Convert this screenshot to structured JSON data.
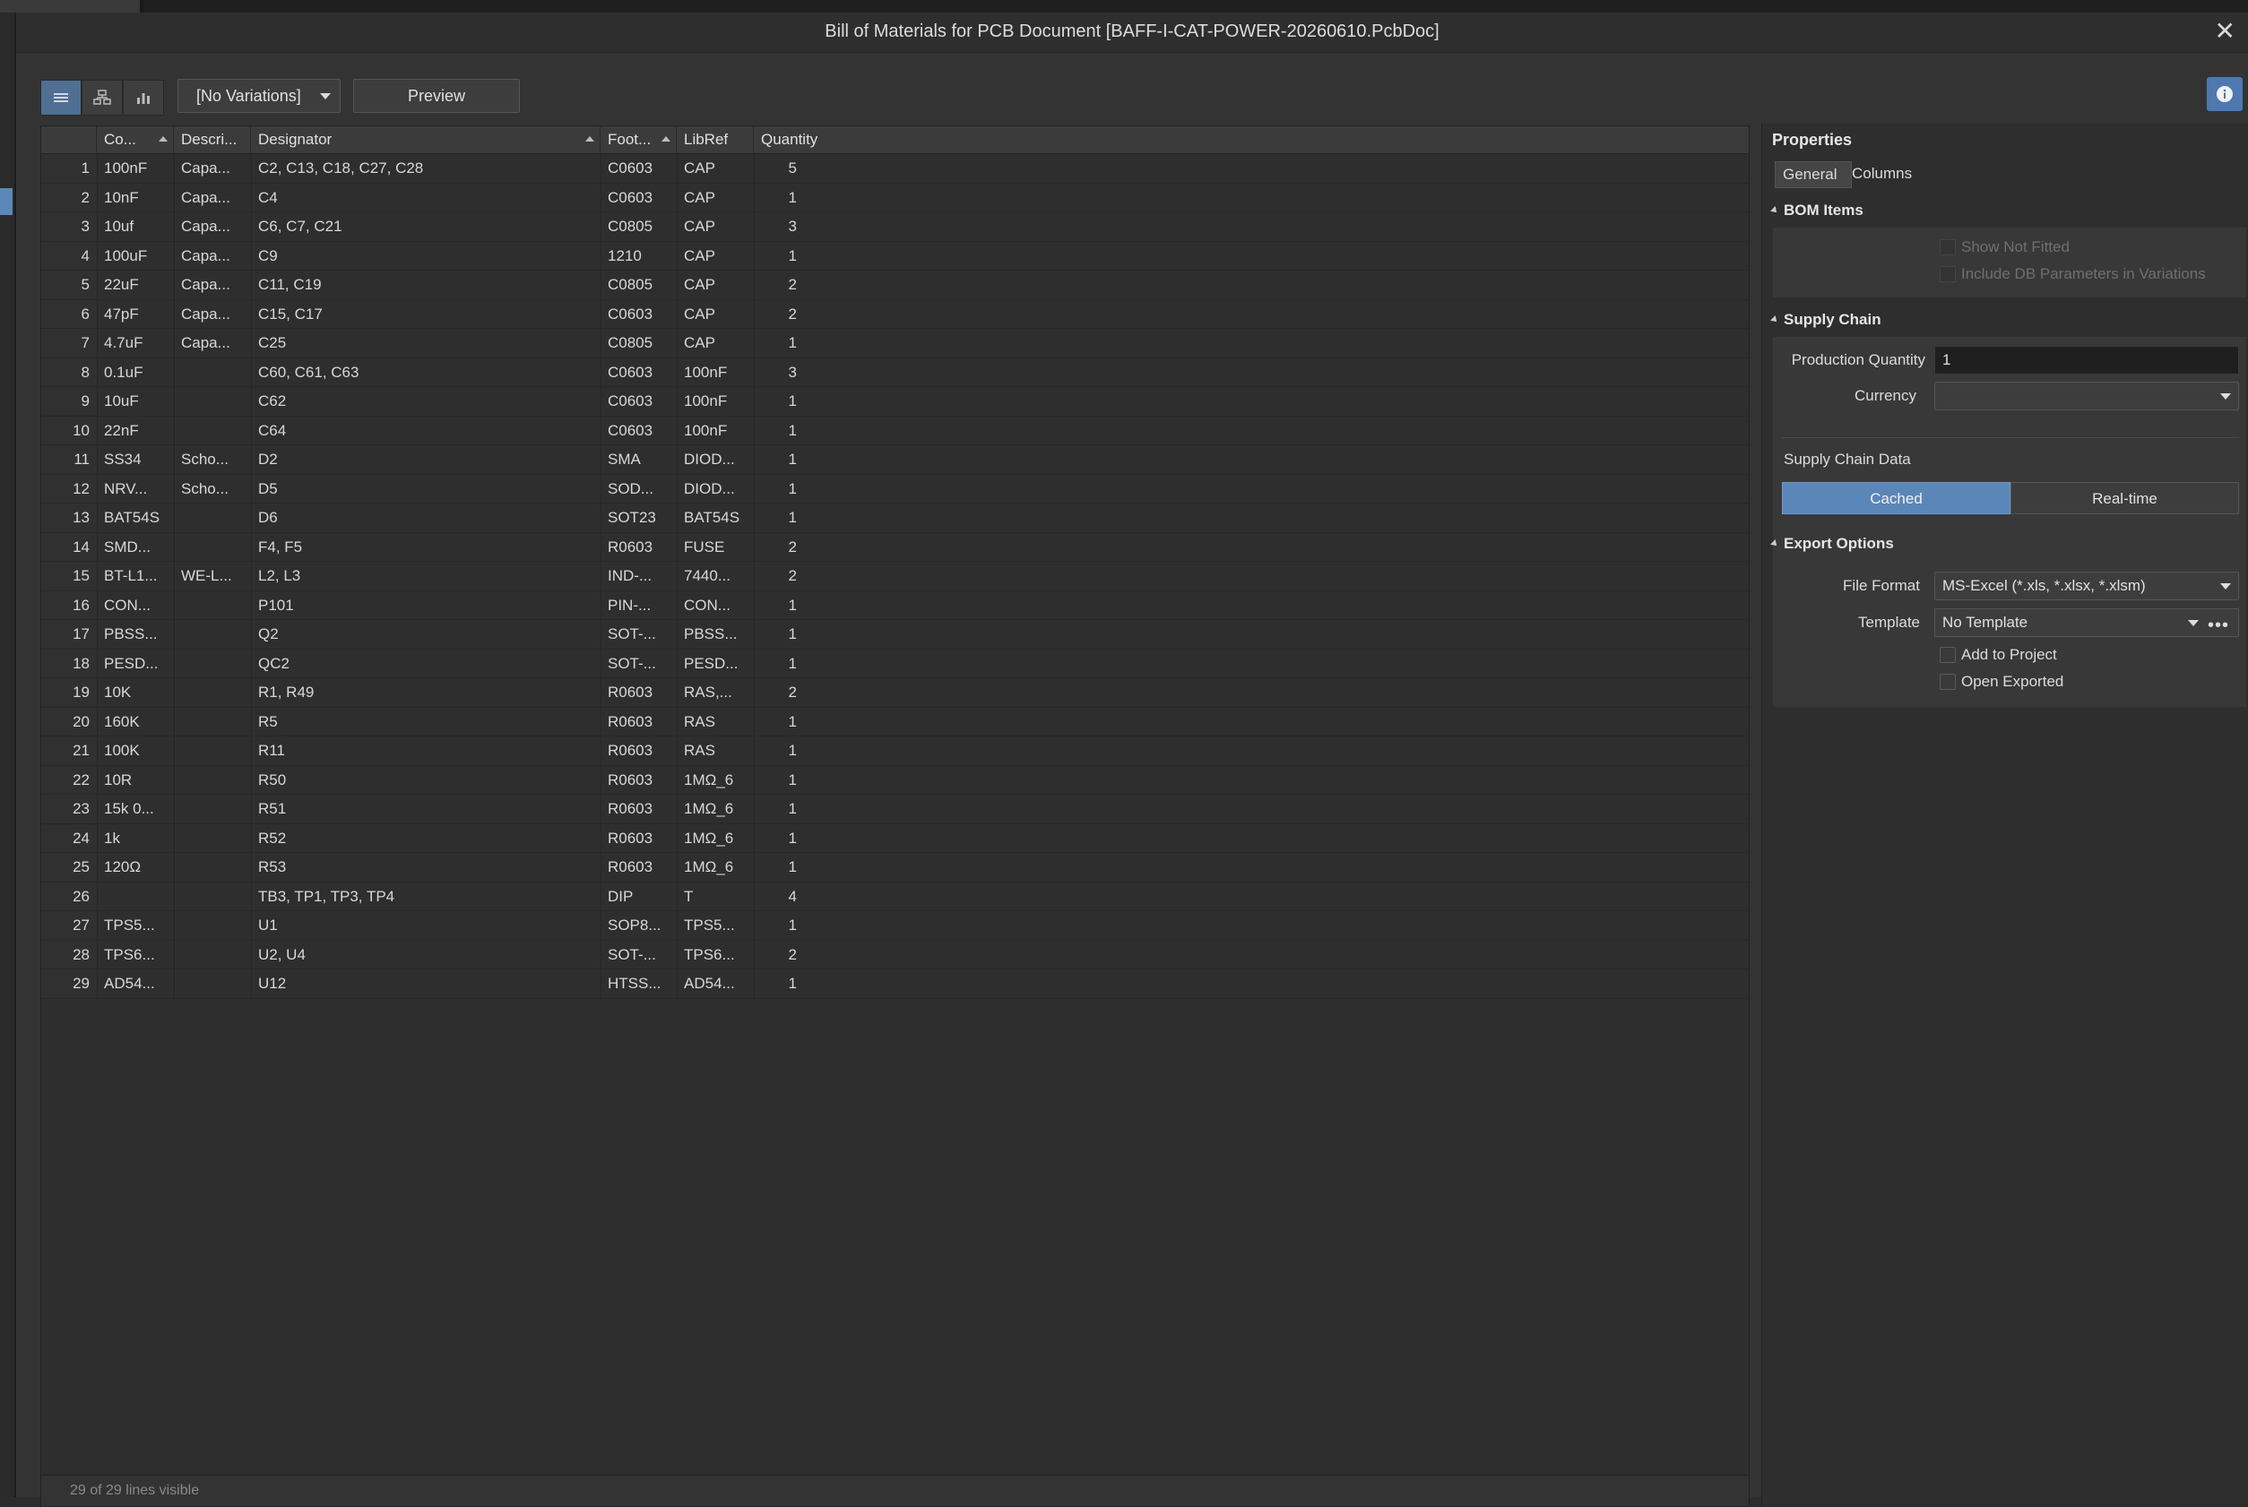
{
  "window": {
    "title": "Bill of Materials for PCB Document [BAFF-I-CAT-POWER-20260610.PcbDoc]",
    "close_glyph": "✕"
  },
  "toolbar": {
    "icons": [
      "list-view-icon",
      "tree-view-icon",
      "chart-view-icon"
    ],
    "variations_label": "[No Variations]",
    "preview_label": "Preview",
    "info_icon": "info-icon"
  },
  "table": {
    "columns": [
      "Co...",
      "Descri...",
      "Designator",
      "Foot...",
      "LibRef",
      "Quantity"
    ],
    "rows": [
      [
        "1",
        "100nF",
        "Capa...",
        "C2, C13, C18, C27, C28",
        "C0603",
        "CAP",
        "5"
      ],
      [
        "2",
        "10nF",
        "Capa...",
        "C4",
        "C0603",
        "CAP",
        "1"
      ],
      [
        "3",
        "10uf",
        "Capa...",
        "C6, C7, C21",
        "C0805",
        "CAP",
        "3"
      ],
      [
        "4",
        "100uF",
        "Capa...",
        "C9",
        "1210",
        "CAP",
        "1"
      ],
      [
        "5",
        "22uF",
        "Capa...",
        "C11, C19",
        "C0805",
        "CAP",
        "2"
      ],
      [
        "6",
        "47pF",
        "Capa...",
        "C15, C17",
        "C0603",
        "CAP",
        "2"
      ],
      [
        "7",
        "4.7uF",
        "Capa...",
        "C25",
        "C0805",
        "CAP",
        "1"
      ],
      [
        "8",
        "0.1uF",
        "",
        "C60, C61, C63",
        "C0603",
        "100nF",
        "3"
      ],
      [
        "9",
        "10uF",
        "",
        "C62",
        "C0603",
        "100nF",
        "1"
      ],
      [
        "10",
        "22nF",
        "",
        "C64",
        "C0603",
        "100nF",
        "1"
      ],
      [
        "11",
        "SS34",
        "Scho...",
        "D2",
        "SMA",
        "DIOD...",
        "1"
      ],
      [
        "12",
        "NRV...",
        "Scho...",
        "D5",
        "SOD...",
        "DIOD...",
        "1"
      ],
      [
        "13",
        "BAT54S",
        "",
        "D6",
        "SOT23",
        "BAT54S",
        "1"
      ],
      [
        "14",
        "SMD...",
        "",
        "F4, F5",
        "R0603",
        "FUSE",
        "2"
      ],
      [
        "15",
        "BT-L1...",
        "WE-L...",
        "L2, L3",
        "IND-...",
        "7440...",
        "2"
      ],
      [
        "16",
        "CON...",
        "",
        "P101",
        "PIN-...",
        "CON...",
        "1"
      ],
      [
        "17",
        "PBSS...",
        "",
        "Q2",
        "SOT-...",
        "PBSS...",
        "1"
      ],
      [
        "18",
        "PESD...",
        "",
        "QC2",
        "SOT-...",
        "PESD...",
        "1"
      ],
      [
        "19",
        "10K",
        "",
        "R1, R49",
        "R0603",
        "RAS,...",
        "2"
      ],
      [
        "20",
        "160K",
        "",
        "R5",
        "R0603",
        "RAS",
        "1"
      ],
      [
        "21",
        "100K",
        "",
        "R11",
        "R0603",
        "RAS",
        "1"
      ],
      [
        "22",
        "10R",
        "",
        "R50",
        "R0603",
        "1MΩ_6",
        "1"
      ],
      [
        "23",
        "15k 0...",
        "",
        "R51",
        "R0603",
        "1MΩ_6",
        "1"
      ],
      [
        "24",
        "1k",
        "",
        "R52",
        "R0603",
        "1MΩ_6",
        "1"
      ],
      [
        "25",
        "120Ω",
        "",
        "R53",
        "R0603",
        "1MΩ_6",
        "1"
      ],
      [
        "26",
        "",
        "",
        "TB3, TP1, TP3, TP4",
        "DIP",
        "T",
        "4"
      ],
      [
        "27",
        "TPS5...",
        "",
        "U1",
        "SOP8...",
        "TPS5...",
        "1"
      ],
      [
        "28",
        "TPS6...",
        "",
        "U2, U4",
        "SOT-...",
        "TPS6...",
        "2"
      ],
      [
        "29",
        "AD54...",
        "",
        "U12",
        "HTSS...",
        "AD54...",
        "1"
      ]
    ],
    "status": "29 of 29 lines visible"
  },
  "properties": {
    "title": "Properties",
    "tabs": [
      "General",
      "Columns"
    ],
    "active_tab": "General",
    "bom_items": {
      "header": "BOM Items",
      "show_not_fitted": "Show Not Fitted",
      "include_db_params": "Include DB Parameters in Variations"
    },
    "supply_chain": {
      "header": "Supply Chain",
      "production_quantity_label": "Production Quantity",
      "production_quantity_value": "1",
      "currency_label": "Currency",
      "currency_value": "",
      "data_label": "Supply Chain Data",
      "cached_label": "Cached",
      "realtime_label": "Real-time",
      "selected": "Cached"
    },
    "export_options": {
      "header": "Export Options",
      "file_format_label": "File Format",
      "file_format_value": "MS-Excel (*.xls, *.xlsx, *.xlsm)",
      "template_label": "Template",
      "template_value": "No Template",
      "more_glyph": "•••",
      "add_to_project": "Add to Project",
      "open_exported": "Open Exported"
    }
  },
  "colors": {
    "accent": "#5b86b8",
    "background": "#333333",
    "panel": "#2e2e2e"
  }
}
